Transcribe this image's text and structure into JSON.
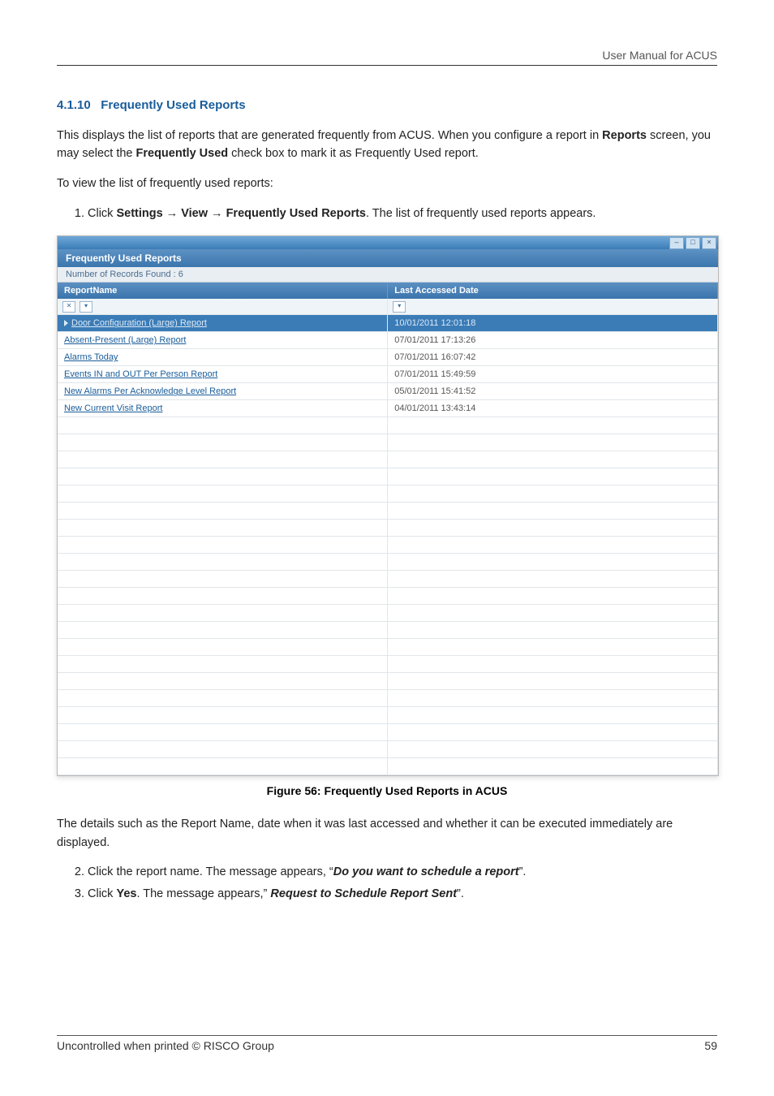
{
  "header": {
    "doc_title": "User Manual for ACUS"
  },
  "section": {
    "number": "4.1.10",
    "title": "Frequently Used Reports"
  },
  "para1_prefix": "This displays the list of reports that are generated frequently from ACUS. When you configure a report in ",
  "para1_bold1": "Reports",
  "para1_mid": " screen, you may select the ",
  "para1_bold2": "Frequently Used",
  "para1_suffix": " check box to mark it as Frequently Used report.",
  "para2": "To view the list of frequently used reports:",
  "step1_prefix": "Click ",
  "step1_b1": "Settings",
  "step1_arrow": " → ",
  "step1_b2": "View",
  "step1_b3": "Frequently Used Reports",
  "step1_suffix": ". The list of frequently used reports appears.",
  "app": {
    "panel_title": "Frequently Used Reports",
    "records_found": "Number of Records Found : 6",
    "columns": {
      "c1": "ReportName",
      "c2": "Last Accessed Date"
    },
    "rows": [
      {
        "name": "Door Configuration (Large) Report",
        "date": "10/01/2011 12:01:18",
        "selected": true
      },
      {
        "name": "Absent-Present (Large) Report",
        "date": "07/01/2011 17:13:26"
      },
      {
        "name": "Alarms Today",
        "date": "07/01/2011 16:07:42"
      },
      {
        "name": "Events IN and OUT Per Person Report",
        "date": "07/01/2011 15:49:59"
      },
      {
        "name": "New Alarms Per Acknowledge Level Report",
        "date": "05/01/2011 15:41:52"
      },
      {
        "name": "New Current Visit Report",
        "date": "04/01/2011 13:43:14"
      }
    ]
  },
  "figure_caption": "Figure 56: Frequently Used Reports in ACUS",
  "para3": "The details such as the Report Name, date when it was last accessed and whether it can be executed immediately are displayed.",
  "step2_prefix": "Click the report name. The message appears, “",
  "step2_bold": "Do you want to schedule a report",
  "step2_suffix": "”.",
  "step3_prefix": "Click ",
  "step3_b1": "Yes",
  "step3_mid": ". The message appears,” ",
  "step3_bold": "Request to Schedule Report Sent",
  "step3_suffix": "”.",
  "footer": {
    "left": "Uncontrolled when printed © RISCO Group",
    "right": "59"
  }
}
